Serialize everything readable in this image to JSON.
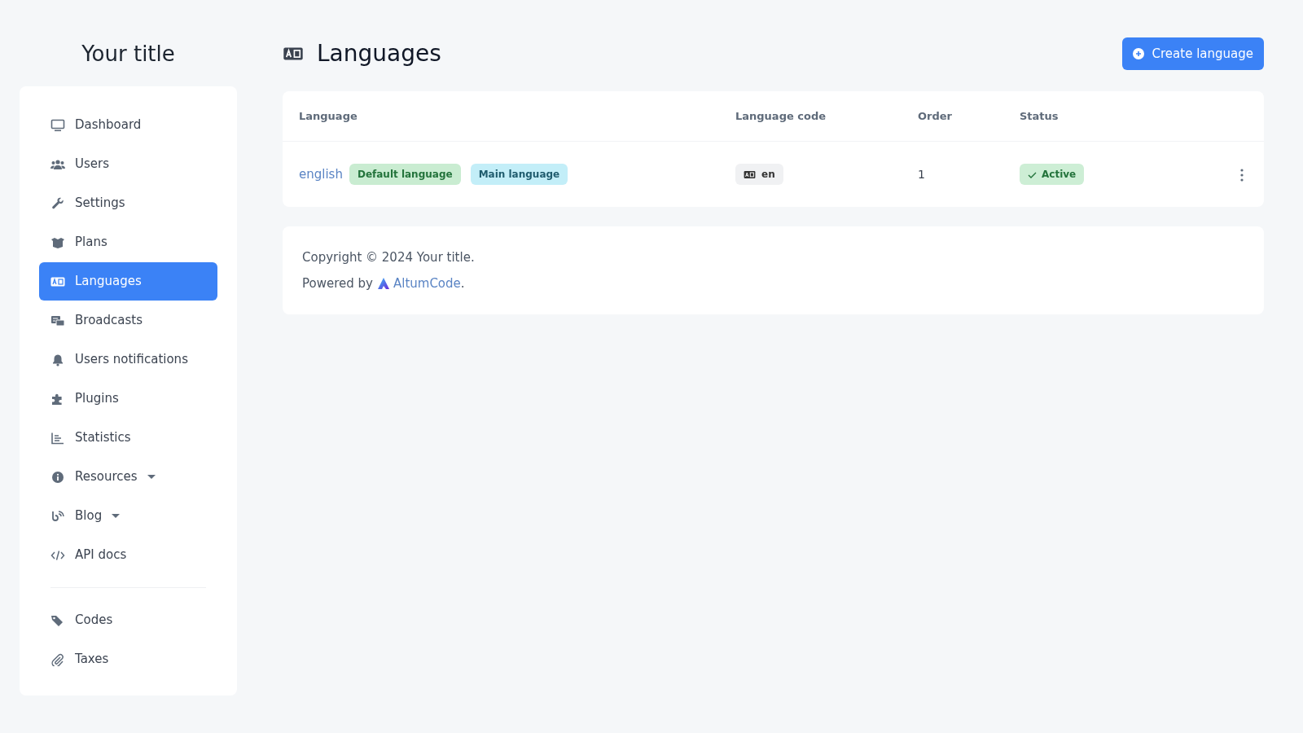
{
  "sidebar": {
    "title": "Your title",
    "sections": [
      [
        {
          "label": "Dashboard",
          "selected": false,
          "dropdown": false
        },
        {
          "label": "Users",
          "selected": false,
          "dropdown": false
        },
        {
          "label": "Settings",
          "selected": false,
          "dropdown": false
        },
        {
          "label": "Plans",
          "selected": false,
          "dropdown": false
        },
        {
          "label": "Languages",
          "selected": true,
          "dropdown": false
        },
        {
          "label": "Broadcasts",
          "selected": false,
          "dropdown": false
        },
        {
          "label": "Users notifications",
          "selected": false,
          "dropdown": false
        },
        {
          "label": "Plugins",
          "selected": false,
          "dropdown": false
        },
        {
          "label": "Statistics",
          "selected": false,
          "dropdown": false
        },
        {
          "label": "Resources",
          "selected": false,
          "dropdown": true
        },
        {
          "label": "Blog",
          "selected": false,
          "dropdown": true
        },
        {
          "label": "API docs",
          "selected": false,
          "dropdown": false
        }
      ],
      [
        {
          "label": "Codes",
          "selected": false,
          "dropdown": false
        },
        {
          "label": "Taxes",
          "selected": false,
          "dropdown": false
        }
      ]
    ]
  },
  "header": {
    "title": "Languages",
    "button": "Create language"
  },
  "table": {
    "columns": [
      "Language",
      "Language code",
      "Order",
      "Status"
    ],
    "rows": [
      {
        "name": "english",
        "badges": [
          {
            "kind": "default",
            "text": "Default language"
          },
          {
            "kind": "main",
            "text": "Main language"
          }
        ],
        "code": "en",
        "order": "1",
        "status": "Active",
        "active": true
      }
    ]
  },
  "footer": {
    "copyright": "Copyright © 2024 Your title.",
    "powered_by": "Powered by",
    "link": "AltumCode",
    "end": "."
  }
}
